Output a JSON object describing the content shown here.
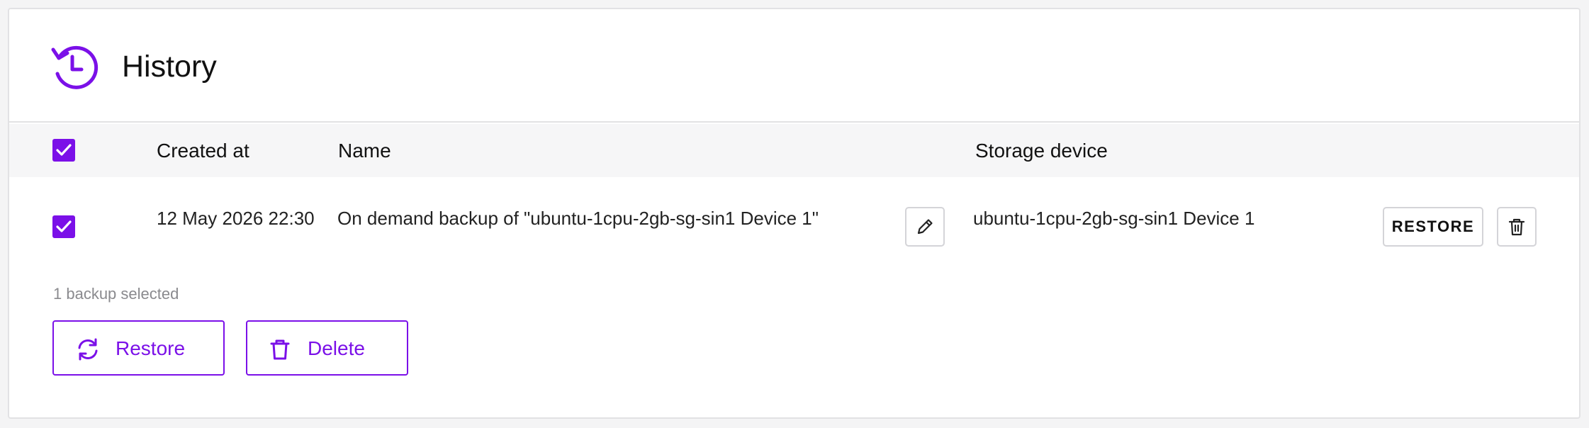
{
  "header": {
    "title": "History",
    "icon": "history-icon"
  },
  "table": {
    "columns": {
      "created_at": "Created at",
      "name": "Name",
      "storage_device": "Storage device"
    },
    "header_checkbox_checked": true,
    "rows": [
      {
        "checked": true,
        "created_at": "12 May 2026 22:30",
        "name": "On demand backup of \"ubuntu-1cpu-2gb-sg-sin1 Device 1\"",
        "storage_device": "ubuntu-1cpu-2gb-sg-sin1 Device 1",
        "restore_label": "RESTORE",
        "edit_icon": "pencil-icon",
        "delete_icon": "trash-icon"
      }
    ]
  },
  "selection": {
    "text": "1 backup selected"
  },
  "actions": {
    "restore_label": "Restore",
    "delete_label": "Delete"
  },
  "colors": {
    "accent": "#7b10e8",
    "border": "#e2e2e4",
    "header_bg": "#f6f6f7",
    "muted_text": "#8a8a8e"
  }
}
